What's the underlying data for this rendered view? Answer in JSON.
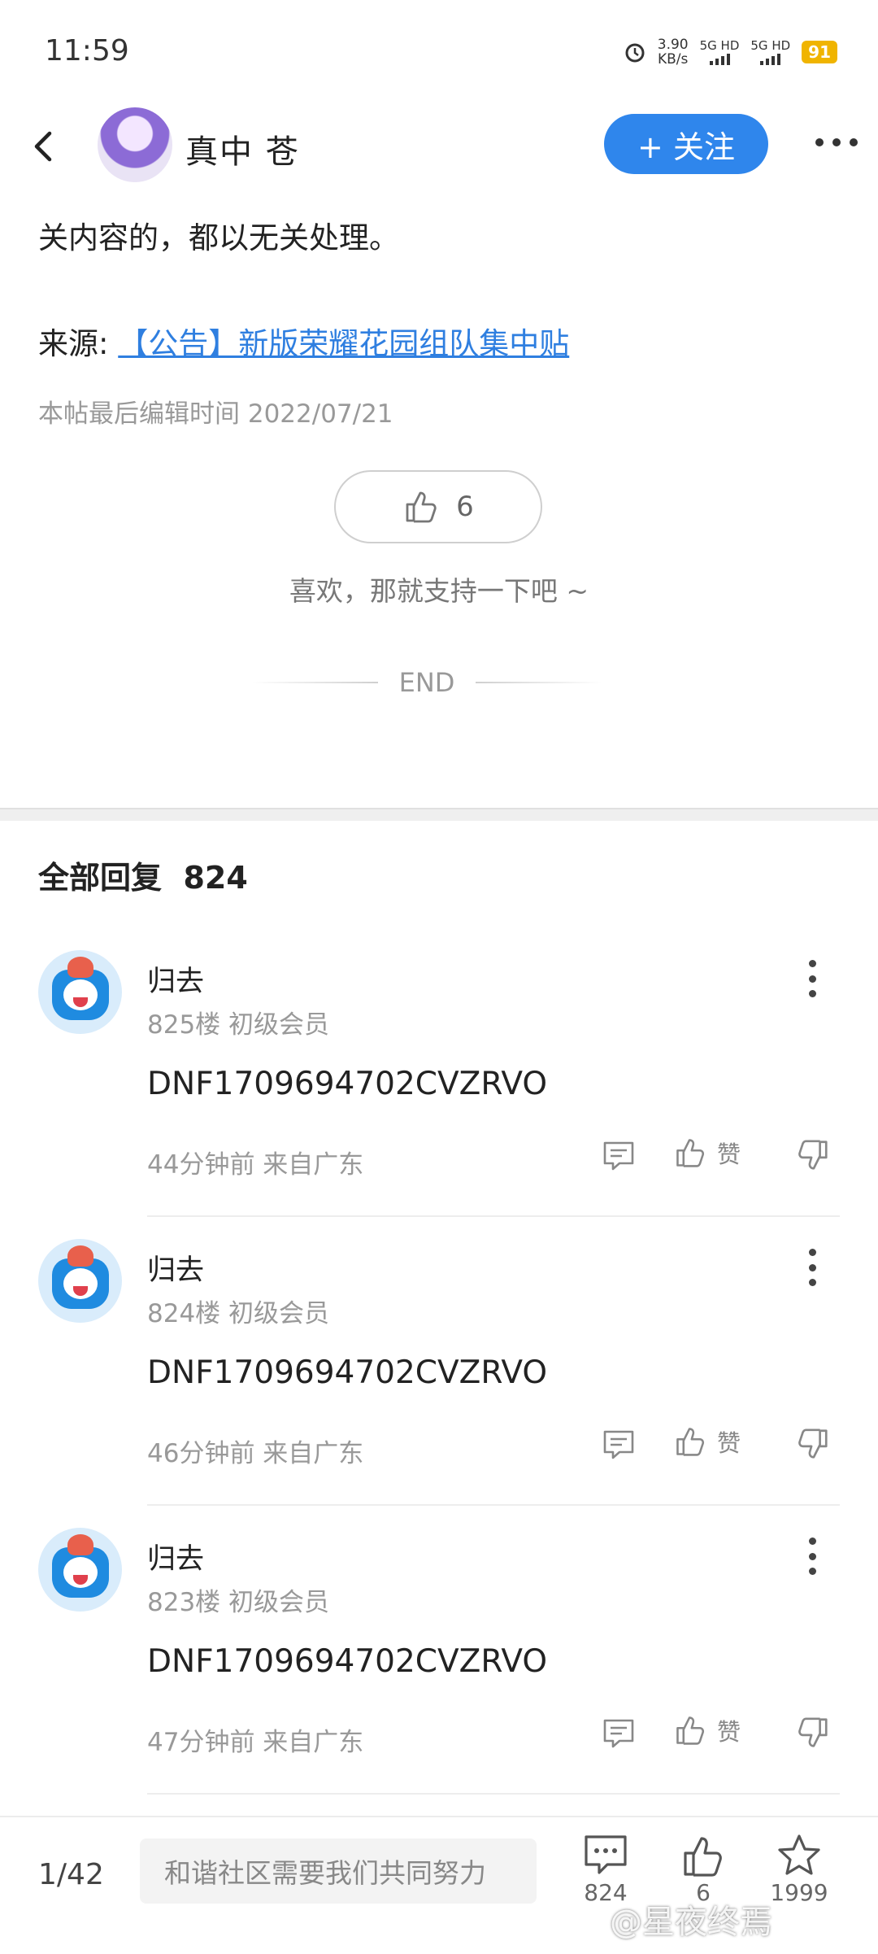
{
  "status_bar": {
    "time": "11:59",
    "net_speed_value": "3.90",
    "net_speed_unit": "KB/s",
    "sim1": "5G HD",
    "sim2": "5G HD",
    "battery": "91"
  },
  "header": {
    "author_name": "真中 苍",
    "follow_label": "+ 关注"
  },
  "article": {
    "content_tail": "关内容的，都以无关处理。",
    "source_prefix": "来源: ",
    "source_link": "【公告】新版荣耀花园组队集中贴",
    "edit_time": "本帖最后编辑时间 2022/07/21",
    "like_count": "6",
    "support_text": "喜欢，那就支持一下吧 ~",
    "end_label": "END"
  },
  "replies": {
    "title": "全部回复",
    "count": "824",
    "items": [
      {
        "name": "归去",
        "meta": "825楼 初级会员",
        "text": "DNF1709694702CVZRVO",
        "time": "44分钟前 来自广东",
        "like_label": "赞"
      },
      {
        "name": "归去",
        "meta": "824楼 初级会员",
        "text": "DNF1709694702CVZRVO",
        "time": "46分钟前 来自广东",
        "like_label": "赞"
      },
      {
        "name": "归去",
        "meta": "823楼 初级会员",
        "text": "DNF1709694702CVZRVO",
        "time": "47分钟前 来自广东",
        "like_label": "赞"
      }
    ]
  },
  "bottom_bar": {
    "page_indicator": "1/42",
    "input_placeholder": "和谐社区需要我们共同努力",
    "comments_count": "824",
    "likes_count": "6",
    "favorites_count": "1999"
  },
  "watermark": "@星夜终焉",
  "colors": {
    "accent": "#2f86ec",
    "link": "#2f7fe0",
    "battery": "#f0b400"
  }
}
